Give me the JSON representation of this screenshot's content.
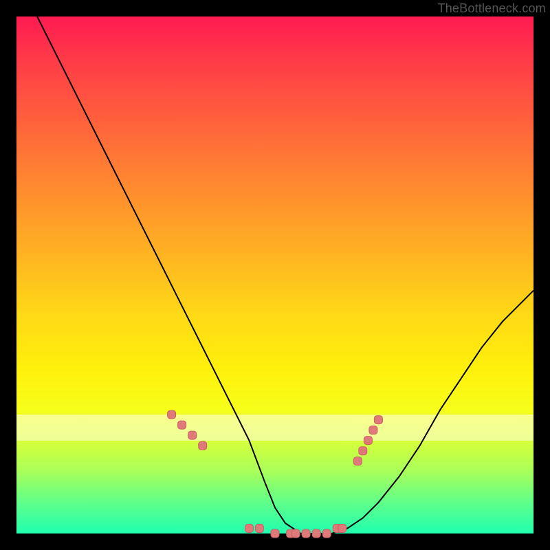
{
  "watermark": "TheBottleneck.com",
  "colors": {
    "black": "#000000",
    "curve": "#000000",
    "marker_fill": "#e07a7a",
    "marker_stroke": "#c86060"
  },
  "chart_data": {
    "type": "line",
    "title": "",
    "xlabel": "",
    "ylabel": "",
    "xlim": [
      0,
      100
    ],
    "ylim": [
      0,
      100
    ],
    "grid": false,
    "legend": false,
    "note": "V-shaped bottleneck curve on a rainbow gradient (red top → green bottom). Minimum near x≈50–60. Pale horizontal band at y≈18–23. Salmon rounded markers sprinkled along the low part of the curve.",
    "series": [
      {
        "name": "curve",
        "x": [
          4,
          10,
          16,
          22,
          28,
          34,
          40,
          45,
          48,
          50,
          52,
          55,
          58,
          61,
          64,
          67,
          70,
          74,
          78,
          82,
          86,
          90,
          94,
          98,
          100
        ],
        "y": [
          100,
          88,
          76,
          64,
          52,
          40,
          28,
          18,
          10,
          5,
          2,
          0,
          0,
          0,
          1,
          3,
          6,
          11,
          17,
          24,
          30,
          36,
          41,
          45,
          47
        ]
      }
    ],
    "markers": {
      "name": "dots",
      "x": [
        30,
        32,
        34,
        36,
        45,
        47,
        50,
        53,
        54,
        56,
        58,
        60,
        62,
        63,
        66,
        67,
        68,
        69,
        70
      ],
      "y": [
        23,
        21,
        19,
        17,
        1,
        1,
        0,
        0,
        0,
        0,
        0,
        0,
        1,
        1,
        14,
        16,
        18,
        20,
        22
      ]
    },
    "band": {
      "y0": 18,
      "y1": 23
    }
  }
}
